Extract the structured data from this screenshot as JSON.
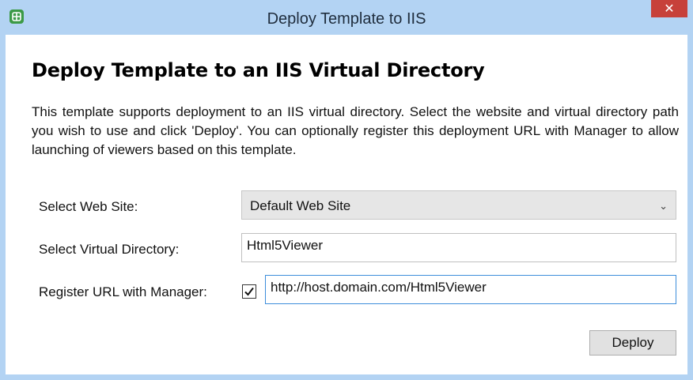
{
  "window": {
    "title": "Deploy Template to IIS",
    "close_glyph": "✕"
  },
  "heading": "Deploy Template to an IIS Virtual Directory",
  "description": "This template supports deployment to an IIS virtual directory. Select the website and virtual directory path you wish to use and click 'Deploy'. You can optionally register this deployment URL with Manager to allow launching of viewers based on this template.",
  "form": {
    "website_label": "Select Web Site:",
    "website_value": "Default Web Site",
    "virtual_dir_label": "Select Virtual Directory:",
    "virtual_dir_value": "Html5Viewer",
    "register_label": "Register URL with Manager:",
    "register_checked": true,
    "register_url_value": "http://host.domain.com/Html5Viewer"
  },
  "buttons": {
    "deploy_label": "Deploy"
  },
  "icons": {
    "app": "app-icon",
    "close": "close-icon",
    "dropdown": "chevron-down-icon",
    "check": "checkmark-icon"
  },
  "colors": {
    "titlebar": "#b3d3f3",
    "close_button": "#c7413a",
    "focus_border": "#3d8edb",
    "app_icon": "#3c9a46"
  }
}
